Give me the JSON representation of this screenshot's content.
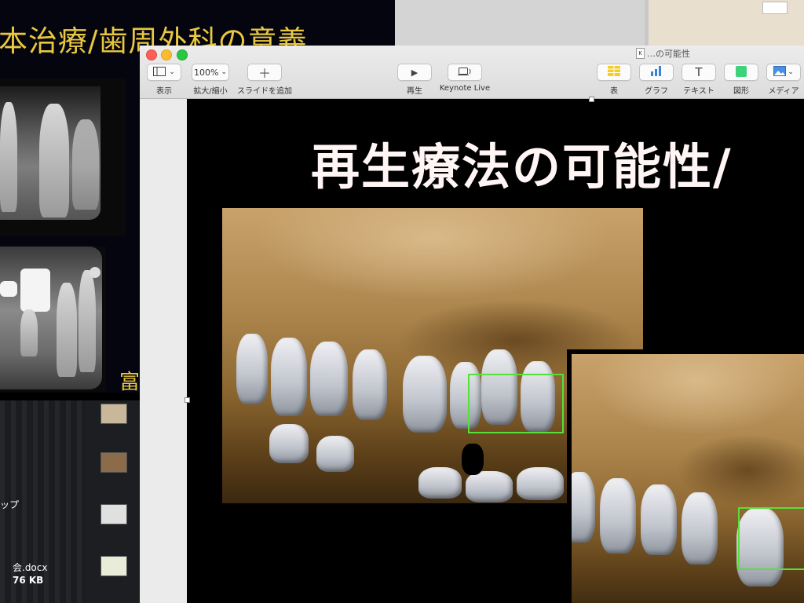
{
  "background_slide": {
    "title": "本治療/歯周外科の意義",
    "partial_text": "富"
  },
  "finder": {
    "items": [
      {
        "label": "ップ"
      },
      {
        "label": "会.docx"
      },
      {
        "label": "76 KB"
      }
    ]
  },
  "keynote": {
    "doc_title": "…の可能性",
    "toolbar": {
      "view": {
        "label": "表示"
      },
      "zoom": {
        "value": "100%",
        "label": "拡大/縮小"
      },
      "add_slide": {
        "label": "スライドを追加"
      },
      "play": {
        "label": "再生"
      },
      "keynote_live": {
        "label": "Keynote Live"
      },
      "table": {
        "label": "表"
      },
      "chart": {
        "label": "グラフ"
      },
      "text": {
        "label": "テキスト"
      },
      "shape": {
        "label": "図形"
      },
      "media": {
        "label": "メディア"
      }
    },
    "slide": {
      "title": "再生療法の可能性/"
    }
  },
  "colors": {
    "accent_yellow": "#e8c840",
    "green_highlight": "#55e03a",
    "shape_green": "#3cd37a",
    "chart_blue": "#3b82d6",
    "table_yellow": "#f5cc2a"
  },
  "icons": [
    "sidebar-view-icon",
    "chevron-down-icon",
    "plus-icon",
    "play-icon",
    "keynote-live-icon",
    "table-icon",
    "chart-icon",
    "text-icon",
    "shape-icon",
    "media-icon"
  ]
}
